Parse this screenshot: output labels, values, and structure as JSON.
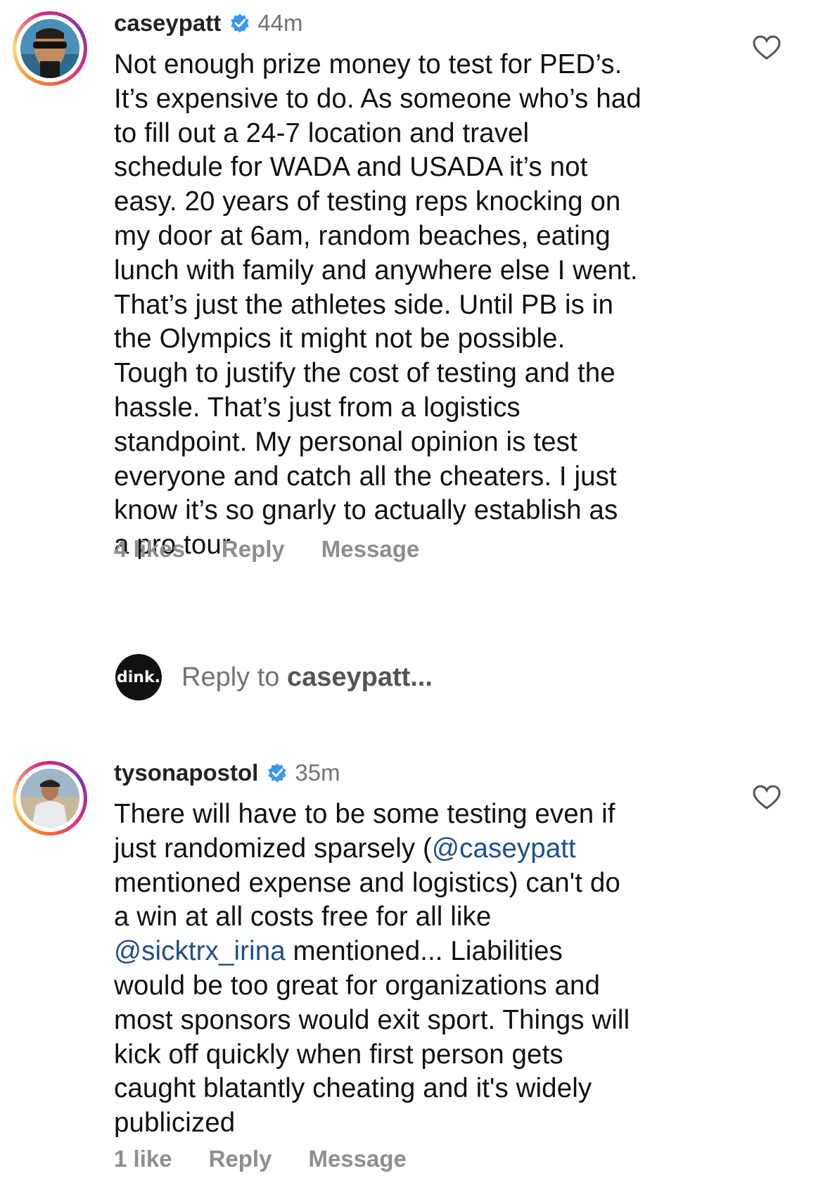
{
  "comments": [
    {
      "username": "caseypatt",
      "time": "44m",
      "lines": [
        "Not enough prize money to test for PED’s.",
        "It’s expensive to do. As someone who’s had",
        "to fill out a 24-7 location and travel",
        "schedule for WADA and USADA it’s not",
        "easy. 20 years of testing reps knocking on",
        "my door at 6am, random beaches, eating",
        "lunch with family and anywhere else I went.",
        "That’s just the athletes side. Until PB is in",
        "the Olympics it might not be possible.",
        "Tough to justify the cost of testing and the",
        "hassle. That’s just from a logistics",
        "standpoint. My personal opinion is test",
        "everyone and catch all the cheaters. I just",
        "know it’s so gnarly to actually establish as",
        "a pro tour."
      ],
      "likes": "4 likes",
      "reply": "Reply",
      "message": "Message"
    },
    {
      "username": "tysonapostol",
      "time": "35m",
      "lines": [
        "There will have to be some testing even if",
        "just randomized sparsely (",
        "@caseypatt",
        "mentioned expense and logistics) can't do",
        "a win at all costs free for all like",
        "@sicktrx_irina",
        " mentioned... Liabilities",
        "would be too great for organizations and",
        "most sponsors would exit sport. Things will",
        "kick off quickly when first person gets",
        "caught blatantly cheating and it's widely",
        "publicized"
      ],
      "likes": "1 like",
      "reply": "Reply",
      "message": "Message"
    }
  ],
  "reply_box": {
    "prefix": "Reply to ",
    "target": "caseypatt",
    "suffix": "...",
    "avatar_text": "dink."
  },
  "colors": {
    "mention": "#1f4f8a",
    "verified": "#3897f0",
    "muted": "#8e8e8e"
  }
}
